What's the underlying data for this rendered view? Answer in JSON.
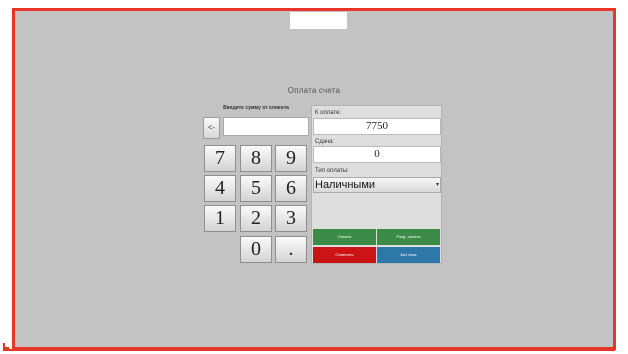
{
  "dialog": {
    "title": "Оплата счета"
  },
  "keypad": {
    "entry_label": "Введите сумму от клиента",
    "backspace_label": "<-",
    "keys": [
      "7",
      "8",
      "9",
      "4",
      "5",
      "6",
      "1",
      "2",
      "3",
      "0",
      "."
    ]
  },
  "payment": {
    "due_label": "К оплате:",
    "due_value": "7750",
    "change_label": "Сдача:",
    "change_value": "0",
    "type_label": "Тип оплаты:",
    "type_value": "Наличными",
    "type_arrow": "▾"
  },
  "buttons": {
    "pay": "Оплата",
    "split": "Разд. оплата",
    "cancel": "Отменить",
    "no_check": "Без чека"
  },
  "colors": {
    "frame": "#e8352a",
    "background": "#c3c3c3",
    "green": "#3c8b46",
    "red": "#cc1416",
    "blue": "#2e77a9"
  }
}
